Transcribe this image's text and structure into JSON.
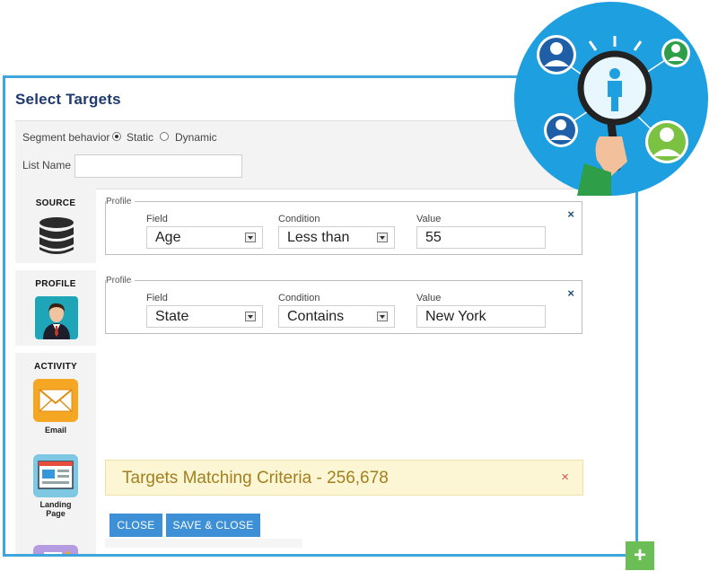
{
  "window": {
    "title": "Select Targets"
  },
  "segment": {
    "label": "Segment behavior",
    "options": [
      {
        "label": "Static",
        "selected": true
      },
      {
        "label": "Dynamic",
        "selected": false
      }
    ]
  },
  "list_name": {
    "label": "List Name",
    "value": ""
  },
  "sidebar": {
    "source": {
      "label": "SOURCE",
      "icon": "database-icon"
    },
    "profile": {
      "label": "PROFILE",
      "icon": "person-icon"
    },
    "activity": {
      "label": "ACTIVITY",
      "items": [
        {
          "label": "Email",
          "icon": "email-icon"
        },
        {
          "label": "Landing Page",
          "icon": "landing-page-icon"
        },
        {
          "label": "",
          "icon": "form-icon"
        }
      ]
    }
  },
  "conditions": [
    {
      "group": "Profile",
      "field_label": "Field",
      "condition_label": "Condition",
      "value_label": "Value",
      "field": "Age",
      "condition": "Less than",
      "value": "55",
      "remove": "×"
    },
    {
      "group": "Profile",
      "field_label": "Field",
      "condition_label": "Condition",
      "value_label": "Value",
      "field": "State",
      "condition": "Contains",
      "value": "New York",
      "remove": "×"
    }
  ],
  "match": {
    "text": "Targets Matching Criteria - 256,678",
    "close": "×"
  },
  "buttons": {
    "close": "CLOSE",
    "save_close": "SAVE & CLOSE"
  },
  "fab": {
    "label": "+"
  },
  "colors": {
    "accent": "#3ea6dc",
    "button": "#3d8fd6",
    "title": "#1e3a6e",
    "match_bg": "#fcf6d4",
    "match_text": "#a3801f",
    "fab": "#6bbd55",
    "badge": "#1e9fe0"
  }
}
